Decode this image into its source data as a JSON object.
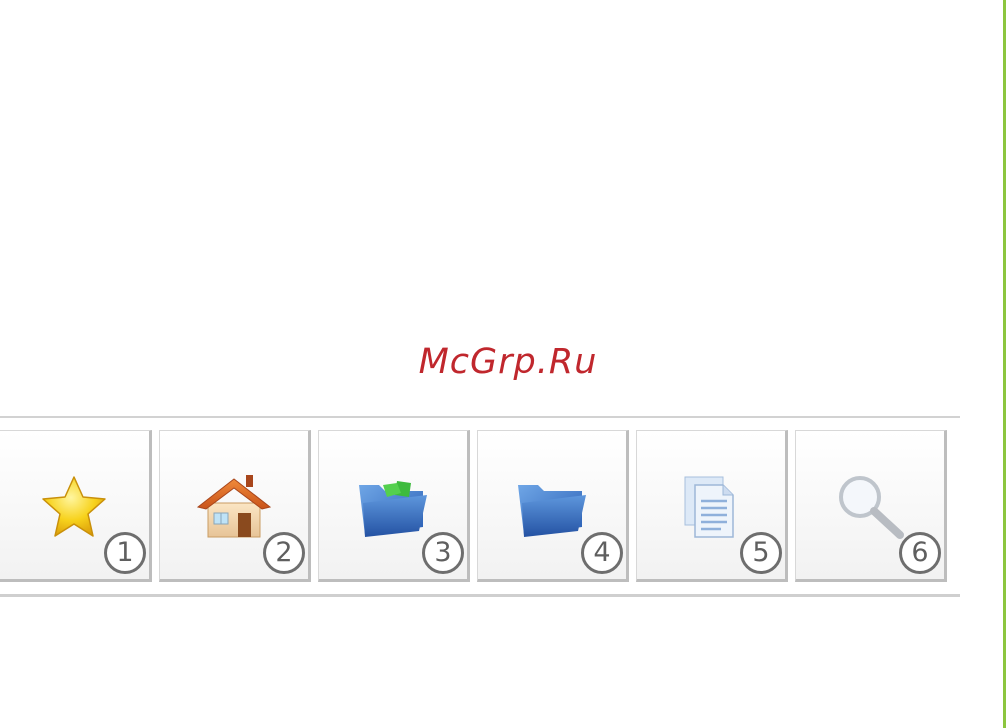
{
  "watermark": {
    "text": "McGrp.Ru",
    "color": "#c0272d"
  },
  "accent_rule_color": "#8cc63f",
  "toolbar": {
    "buttons": [
      {
        "icon": "star-icon",
        "number": "1"
      },
      {
        "icon": "home-icon",
        "number": "2"
      },
      {
        "icon": "folder-sync-icon",
        "number": "3"
      },
      {
        "icon": "folder-icon",
        "number": "4"
      },
      {
        "icon": "document-icon",
        "number": "5"
      },
      {
        "icon": "search-icon",
        "number": "6"
      }
    ]
  }
}
